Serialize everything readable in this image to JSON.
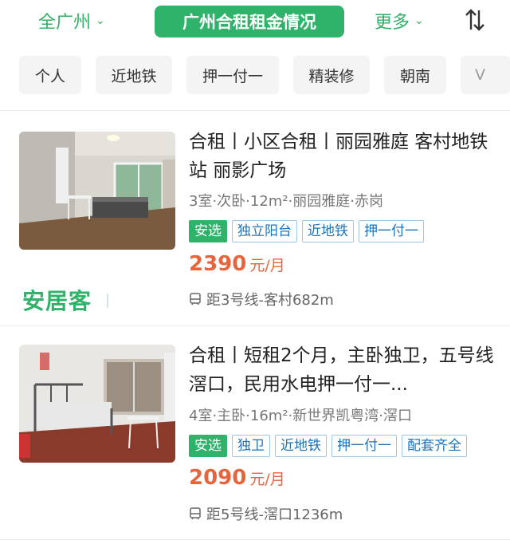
{
  "header": {
    "city": "全广州",
    "title": "广州合租租金情况",
    "more": "更多"
  },
  "filters": [
    "个人",
    "近地铁",
    "押一付一",
    "精装修",
    "朝南",
    "V"
  ],
  "listings": [
    {
      "title": "合租丨小区合租丨丽园雅庭 客村地铁站 丽影广场",
      "meta": "3室·次卧·12m²·丽园雅庭·赤岗",
      "tags": [
        "安选",
        "独立阳台",
        "近地铁",
        "押一付一"
      ],
      "price": "2390",
      "price_unit": "元/月",
      "distance": "距3号线-客村682m"
    },
    {
      "title": "合租丨短租2个月，主卧独卫，五号线滘口，民用水电押一付一...",
      "meta": "4室·主卧·16m²·新世界凯粤湾·滘口",
      "tags": [
        "安选",
        "独卫",
        "近地铁",
        "押一付一",
        "配套齐全"
      ],
      "price": "2090",
      "price_unit": "元/月",
      "distance": "距5号线-滘口1236m"
    }
  ],
  "brand_logo": "安居客",
  "colors": {
    "accent": "#2fb36b",
    "price": "#e8643c",
    "tag_blue": "#1e73b8"
  },
  "icons": {
    "city_dropdown": "chevron-down-icon",
    "sort": "sort-arrows-icon",
    "distance": "bus-icon"
  }
}
